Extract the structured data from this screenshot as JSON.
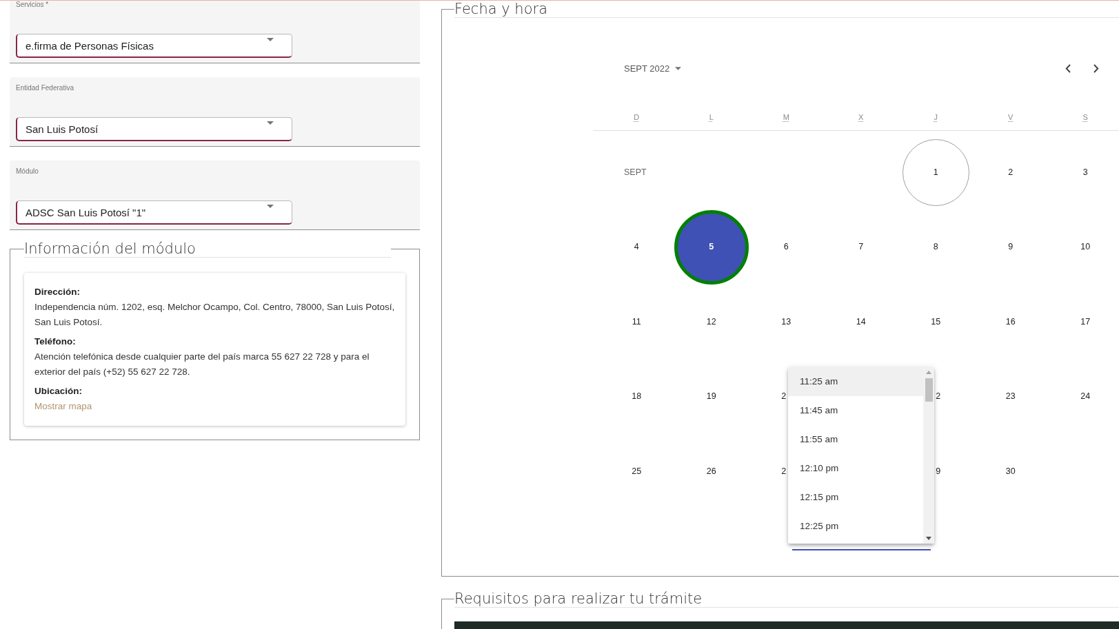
{
  "service_form": {
    "fields": [
      {
        "label": "Servicios *",
        "value": "e.firma de Personas Físicas"
      },
      {
        "label": "Entidad Federativa",
        "value": "San Luis Potosí"
      },
      {
        "label": "Módulo",
        "value": "ADSC San Luis Potosí \"1\""
      }
    ]
  },
  "module_info": {
    "title": "Información del módulo",
    "sections": [
      {
        "heading": "Dirección:",
        "text": "Independencia núm. 1202, esq. Melchor Ocampo, Col. Centro, 78000, San Luis Potosí, San Luis Potosí."
      },
      {
        "heading": "Teléfono:",
        "text": "Atención telefónica desde cualquier parte del país marca 55 627 22 728 y para el exterior del país (+52) 55 627 22 728."
      },
      {
        "heading": "Ubicación:",
        "link": "Mostrar mapa"
      }
    ]
  },
  "date_time": {
    "title": "Fecha y hora",
    "calendar": {
      "period": "SEPT 2022",
      "weekdays": [
        "D",
        "L",
        "M",
        "X",
        "J",
        "V",
        "S"
      ],
      "month_label": "SEPT",
      "weeks": [
        {
          "days": [
            {
              "kind": "day",
              "day": "1",
              "today": true,
              "selected": false
            },
            {
              "kind": "day",
              "day": "2",
              "today": false,
              "selected": false
            },
            {
              "kind": "day",
              "day": "3",
              "today": false,
              "selected": false
            }
          ]
        },
        {
          "days": [
            {
              "kind": "day",
              "day": "4",
              "today": false,
              "selected": false
            },
            {
              "kind": "day",
              "day": "5",
              "today": false,
              "selected": true
            },
            {
              "kind": "day",
              "day": "6",
              "today": false,
              "selected": false
            },
            {
              "kind": "day",
              "day": "7",
              "today": false,
              "selected": false
            },
            {
              "kind": "day",
              "day": "8",
              "today": false,
              "selected": false
            },
            {
              "kind": "day",
              "day": "9",
              "today": false,
              "selected": false
            },
            {
              "kind": "day",
              "day": "10",
              "today": false,
              "selected": false
            }
          ]
        },
        {
          "days": [
            {
              "kind": "day",
              "day": "11",
              "today": false,
              "selected": false
            },
            {
              "kind": "day",
              "day": "12",
              "today": false,
              "selected": false
            },
            {
              "kind": "day",
              "day": "13",
              "today": false,
              "selected": false
            },
            {
              "kind": "day",
              "day": "14",
              "today": false,
              "selected": false
            },
            {
              "kind": "day",
              "day": "15",
              "today": false,
              "selected": false
            },
            {
              "kind": "day",
              "day": "16",
              "today": false,
              "selected": false
            },
            {
              "kind": "day",
              "day": "17",
              "today": false,
              "selected": false
            }
          ]
        },
        {
          "days": [
            {
              "kind": "day",
              "day": "18",
              "today": false,
              "selected": false
            },
            {
              "kind": "day",
              "day": "19",
              "today": false,
              "selected": false
            },
            {
              "kind": "head",
              "day": "2",
              "today": false,
              "selected": false
            },
            {
              "kind": "covered"
            },
            {
              "kind": "tail",
              "day": "2",
              "today": false,
              "selected": false
            },
            {
              "kind": "day",
              "day": "23",
              "today": false,
              "selected": false
            },
            {
              "kind": "day",
              "day": "24",
              "today": false,
              "selected": false
            }
          ]
        },
        {
          "days": [
            {
              "kind": "day",
              "day": "25",
              "today": false,
              "selected": false
            },
            {
              "kind": "day",
              "day": "26",
              "today": false,
              "selected": false
            },
            {
              "kind": "head",
              "day": "2",
              "today": false,
              "selected": false
            },
            {
              "kind": "covered"
            },
            {
              "kind": "tail",
              "day": "9",
              "today": false,
              "selected": false
            },
            {
              "kind": "day",
              "day": "30",
              "today": false,
              "selected": false
            }
          ]
        }
      ]
    },
    "time_options": [
      {
        "label": "11:25 am",
        "selected": true
      },
      {
        "label": "11:45 am",
        "selected": false
      },
      {
        "label": "11:55 am",
        "selected": false
      },
      {
        "label": "12:10 pm",
        "selected": false
      },
      {
        "label": "12:15 pm",
        "selected": false
      },
      {
        "label": "12:25 pm",
        "selected": false
      }
    ]
  },
  "requirements": {
    "title": "Requisitos para realizar tu trámite"
  }
}
